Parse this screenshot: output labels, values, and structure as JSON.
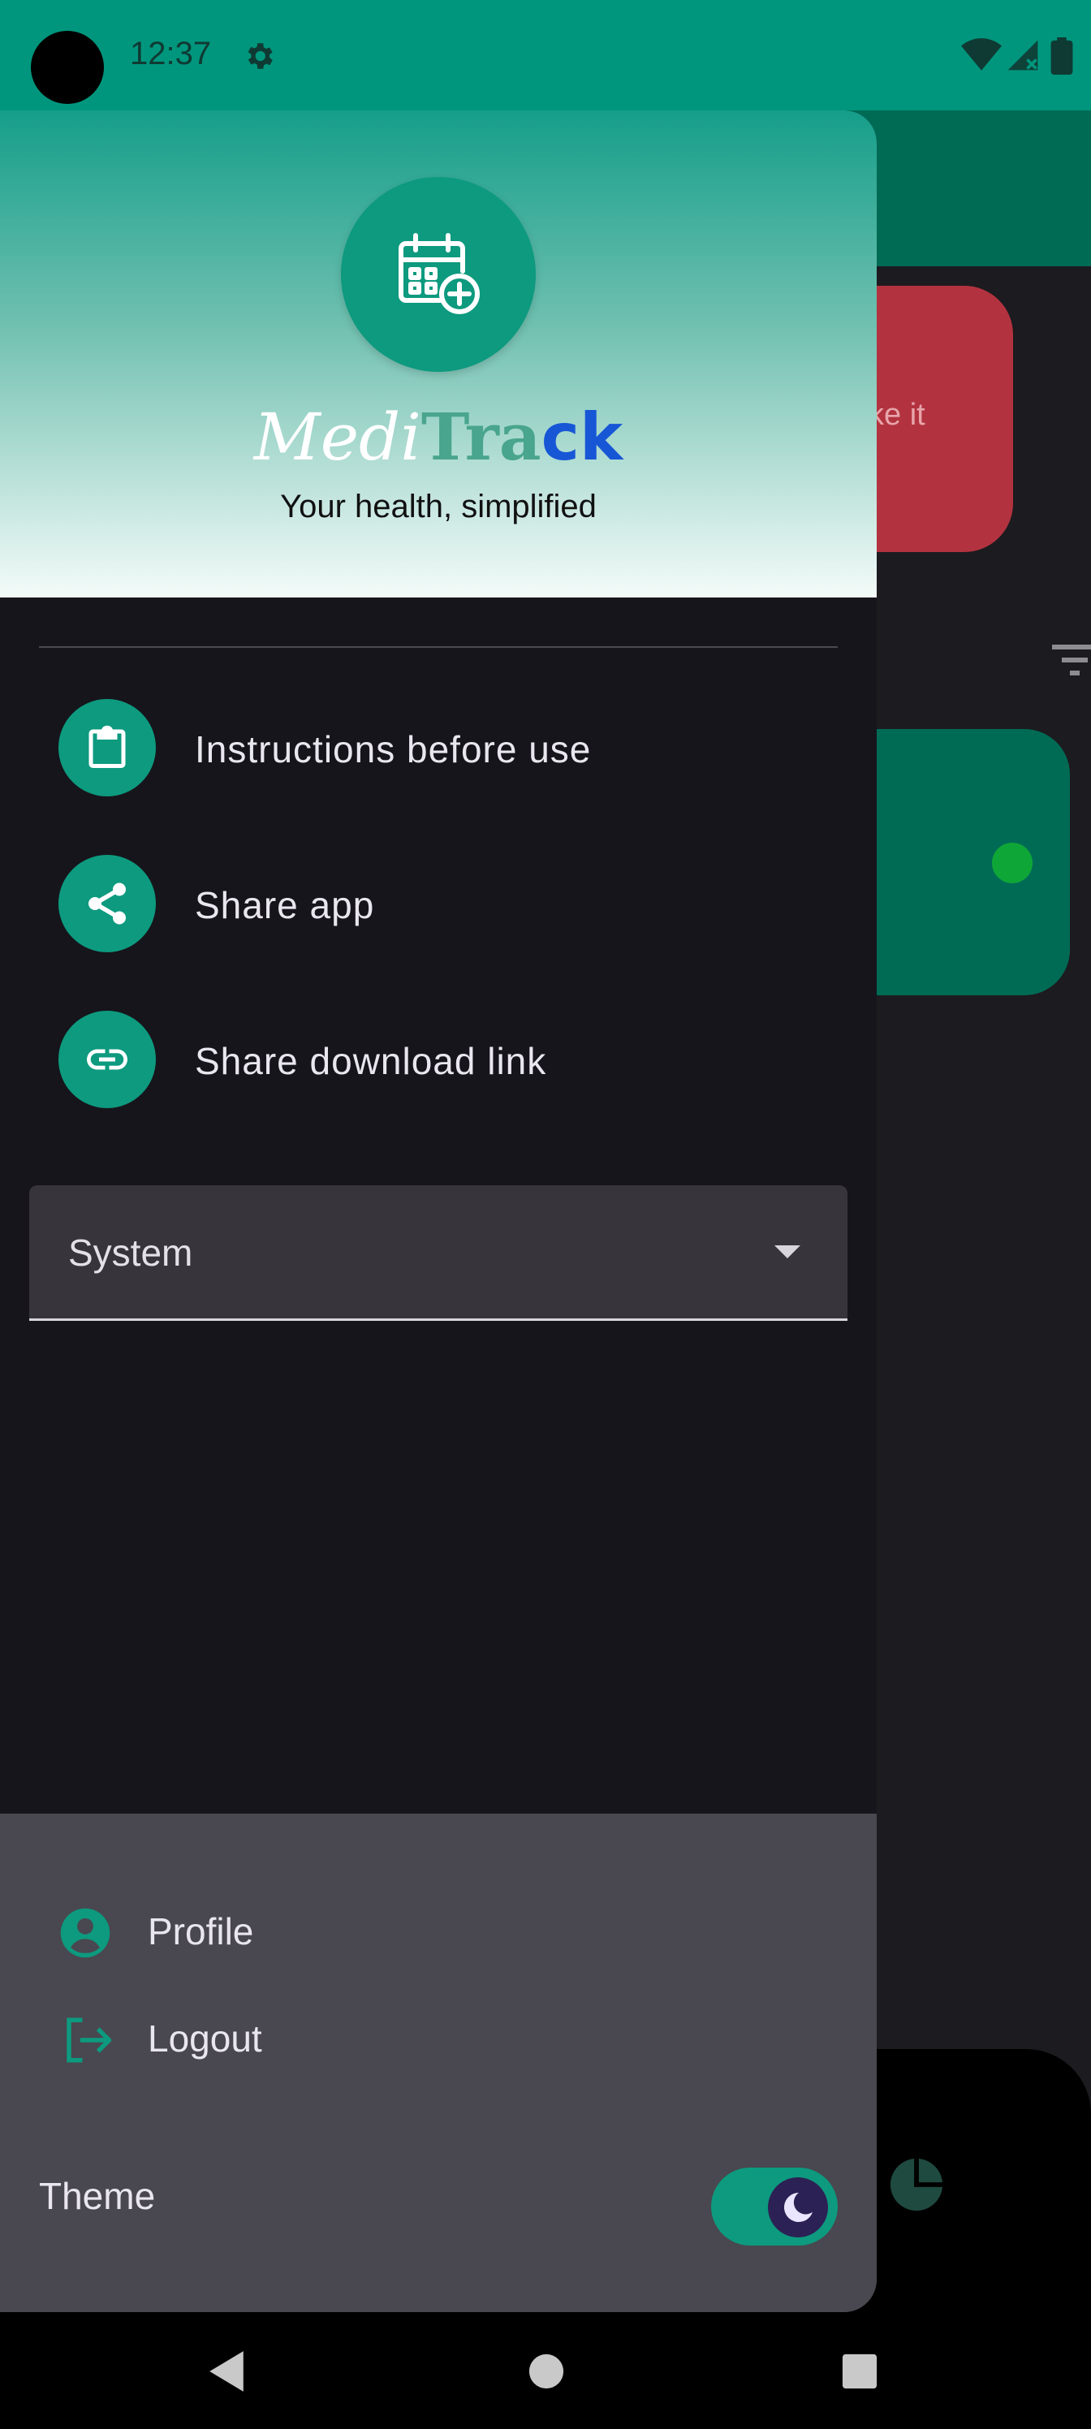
{
  "status_bar": {
    "time": "12:37",
    "icons": [
      "camera-cutout",
      "gear-icon",
      "wifi-icon",
      "signal-icon",
      "battery-icon"
    ]
  },
  "background": {
    "red_card_text": "ke it"
  },
  "drawer": {
    "brand": {
      "part1": "Medi",
      "part2": "Tra",
      "part3": "ck"
    },
    "tagline": "Your health, simplified",
    "menu": [
      {
        "label": "Instructions before use",
        "icon": "clipboard-icon"
      },
      {
        "label": "Share app",
        "icon": "share-icon"
      },
      {
        "label": "Share download link",
        "icon": "link-icon"
      }
    ],
    "dropdown": {
      "value": "System"
    },
    "footer": {
      "items": [
        {
          "label": "Profile",
          "icon": "account-circle-icon"
        },
        {
          "label": "Logout",
          "icon": "logout-icon"
        }
      ],
      "theme_label": "Theme",
      "theme_toggle_on": true
    }
  },
  "colors": {
    "accent": "#0d9a7f",
    "status_bar": "#00967d",
    "drawer_bg": "#16151b",
    "footer_bg": "#49474f",
    "brand_blue": "#1757d6"
  }
}
